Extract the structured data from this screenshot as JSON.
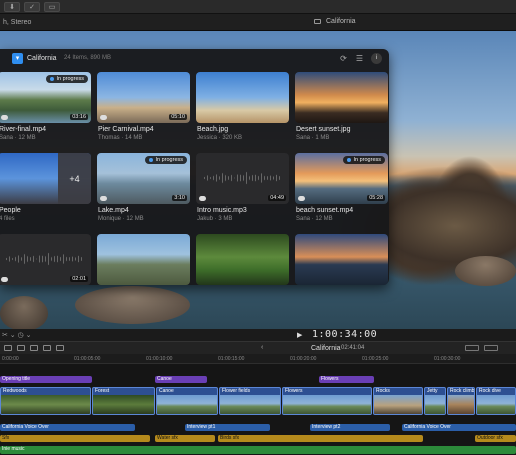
{
  "window": {
    "subtitle_left": "h, Stereo",
    "library_title": "California"
  },
  "browser": {
    "title": "California",
    "meta": "24 Items, 890 MB",
    "more_label": "i"
  },
  "tiles": [
    {
      "name": "River-final.mp4",
      "sub": "Sana  ·  12 MB",
      "badge": "In progress",
      "duration": "03:16",
      "thumb": "river"
    },
    {
      "name": "Pier Carnival.mp4",
      "sub": "Thomas  ·  14 MB",
      "badge": "",
      "duration": "05:10",
      "thumb": "pier"
    },
    {
      "name": "Beach.jpg",
      "sub": "Jessica  ·  320 KB",
      "badge": "",
      "duration": "",
      "thumb": "beach"
    },
    {
      "name": "Desert sunset.jpg",
      "sub": "Sana  ·  1 MB",
      "badge": "",
      "duration": "",
      "thumb": "desert"
    },
    {
      "name": "People",
      "sub": "4 files",
      "badge": "",
      "duration": "",
      "thumb": "people",
      "more": "+4"
    },
    {
      "name": "Lake.mp4",
      "sub": "Monique  ·  12 MB",
      "badge": "In progress",
      "duration": "3:10",
      "thumb": "lake"
    },
    {
      "name": "Intro music.mp3",
      "sub": "Jakub  ·  3 MB",
      "badge": "",
      "duration": "04:49",
      "thumb": "audio"
    },
    {
      "name": "beach sunset.mp4",
      "sub": "Sana  ·  12 MB",
      "badge": "In progress",
      "duration": "05:28",
      "thumb": "sunset"
    },
    {
      "name": "",
      "sub": "",
      "badge": "",
      "duration": "02:01",
      "thumb": "audio"
    },
    {
      "name": "",
      "sub": "",
      "badge": "",
      "duration": "",
      "thumb": "coast"
    },
    {
      "name": "",
      "sub": "",
      "badge": "",
      "duration": "",
      "thumb": "forest"
    },
    {
      "name": "",
      "sub": "",
      "badge": "",
      "duration": "",
      "thumb": "dusk"
    }
  ],
  "transport": {
    "play": "▶",
    "timecode": "1:00:34:00"
  },
  "timeline": {
    "back": "‹",
    "project": "California",
    "project_timecode": "02:41:04",
    "ruler": [
      "0:00:00",
      "01:00:05:00",
      "01:00:10:00",
      "01:00:15:00",
      "01:00:20:00",
      "01:00:25:00",
      "01:00:30:00"
    ],
    "titles": [
      "Opening title",
      "Canoe",
      "Flowers"
    ],
    "video_clips": [
      "Redwoods",
      "Forest",
      "Canoe",
      "Flower fields",
      "Flowers",
      "Rocks",
      "Jetty",
      "Rock climb",
      "Rock dive"
    ],
    "voice": [
      "California Voice Over",
      "Interview pt1",
      "Interview pt2",
      "California Voice Over"
    ],
    "sfx": [
      "Sfx",
      "Water sfx",
      "Birds sfx",
      "Outdoor sfx"
    ],
    "music": "Inie music"
  }
}
